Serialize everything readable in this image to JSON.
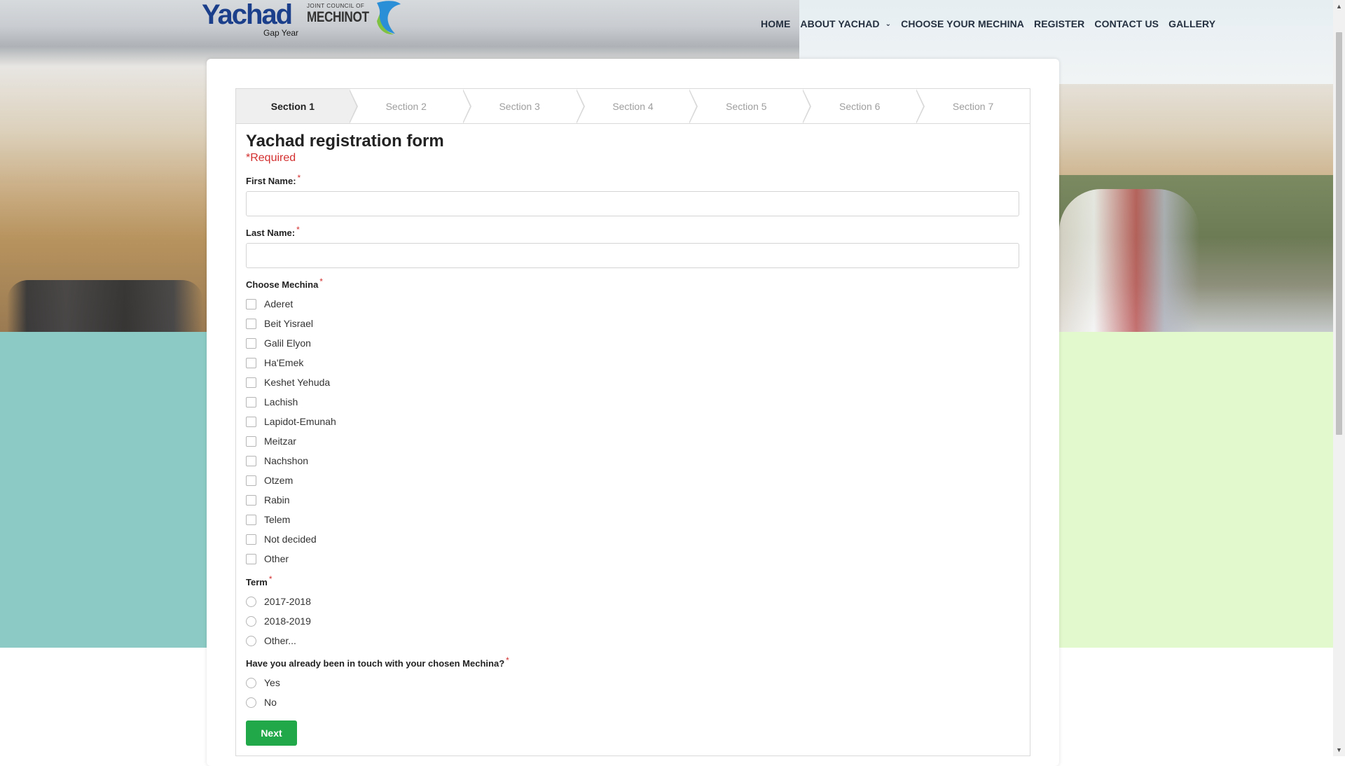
{
  "header": {
    "logo": {
      "name": "Yachad",
      "tagline": "Gap Year",
      "partner_small": "JOINT COUNCIL OF",
      "partner_large": "MECHINOT"
    },
    "nav": [
      {
        "label": "HOME",
        "dropdown": false
      },
      {
        "label": "ABOUT YACHAD",
        "dropdown": true
      },
      {
        "label": "CHOOSE YOUR MECHINA",
        "dropdown": false
      },
      {
        "label": "REGISTER",
        "dropdown": false
      },
      {
        "label": "CONTACT US",
        "dropdown": false
      },
      {
        "label": "GALLERY",
        "dropdown": false
      }
    ]
  },
  "steps": {
    "active_index": 0,
    "items": [
      "Section 1",
      "Section 2",
      "Section 3",
      "Section 4",
      "Section 5",
      "Section 6",
      "Section 7"
    ]
  },
  "form": {
    "title": "Yachad registration form",
    "required_note": "*Required",
    "required_marker": "*",
    "first_name": {
      "label": "First Name:",
      "value": ""
    },
    "last_name": {
      "label": "Last Name:",
      "value": ""
    },
    "mechina": {
      "label": "Choose Mechina",
      "options": [
        "Aderet",
        "Beit Yisrael",
        "Galil Elyon",
        "Ha'Emek",
        "Keshet Yehuda",
        "Lachish",
        "Lapidot-Emunah",
        "Meitzar",
        "Nachshon",
        "Otzem",
        "Rabin",
        "Telem",
        "Not decided",
        "Other"
      ]
    },
    "term": {
      "label": "Term",
      "options": [
        "2017-2018",
        "2018-2019",
        "Other..."
      ]
    },
    "contact": {
      "label": "Have you already been in touch with your chosen Mechina?",
      "options": [
        "Yes",
        "No"
      ]
    },
    "next_label": "Next"
  },
  "colors": {
    "accent_green": "#21a849",
    "required_red": "#d32f2f",
    "nav_text": "#253040",
    "teal_band": "#8ccac5",
    "green_band": "#e2f9cd"
  },
  "icons": [
    "chevron-down-icon",
    "logo-bird-icon",
    "scroll-up-icon",
    "scroll-down-icon"
  ]
}
